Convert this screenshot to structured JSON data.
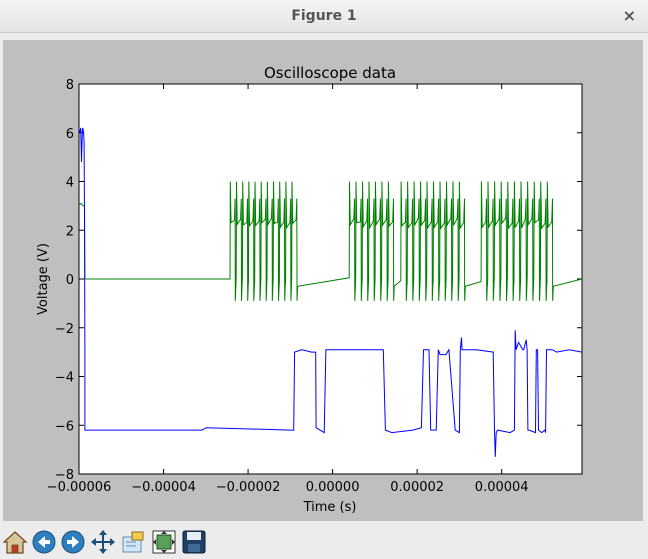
{
  "window": {
    "title": "Figure 1",
    "close_glyph": "×"
  },
  "toolbar": {
    "buttons": [
      {
        "name": "home-icon",
        "tooltip": "Home"
      },
      {
        "name": "back-icon",
        "tooltip": "Back"
      },
      {
        "name": "forward-icon",
        "tooltip": "Forward"
      },
      {
        "name": "pan-icon",
        "tooltip": "Pan"
      },
      {
        "name": "zoom-icon",
        "tooltip": "Zoom"
      },
      {
        "name": "subplots-icon",
        "tooltip": "Subplots"
      },
      {
        "name": "save-icon",
        "tooltip": "Save"
      }
    ]
  },
  "chart_data": {
    "type": "line",
    "title": "Oscilloscope data",
    "xlabel": "Time (s)",
    "ylabel": "Voltage (V)",
    "xlim": [
      -6e-05,
      5.9e-05
    ],
    "ylim": [
      -8,
      8
    ],
    "xticks": [
      -6e-05,
      -4e-05,
      -2e-05,
      0.0,
      2e-05,
      4e-05
    ],
    "xtick_labels": [
      "−0.00006",
      "−0.00004",
      "−0.00002",
      "0.00000",
      "0.00002",
      "0.00004"
    ],
    "yticks": [
      -8,
      -6,
      -4,
      -2,
      0,
      2,
      4,
      6,
      8
    ],
    "ytick_labels": [
      "−8",
      "−6",
      "−4",
      "−2",
      "0",
      "2",
      "4",
      "6",
      "8"
    ],
    "grid": false,
    "series": [
      {
        "color": "#0000ff",
        "x": [
          -6.1e-05,
          -6.05e-05,
          -6.03e-05,
          -5.98e-05,
          -5.96e-05,
          -5.94e-05,
          -5.92e-05,
          -5.91e-05,
          -5.89e-05,
          -5.88e-05,
          -5.87e-05,
          -5.86e-05,
          -5.86e-05,
          -5.84e-05,
          -3.09e-05,
          -2.99e-05,
          -9.9e-06,
          -9.2e-06,
          -9e-06,
          -7.3e-06,
          -5e-06,
          -4e-06,
          -3.9e-06,
          -2e-06,
          -1.6e-06,
          -1.5e-06,
          3e-06,
          5e-06,
          1.2e-05,
          1.25e-05,
          1.4e-05,
          1.9e-05,
          2.1e-05,
          2.15e-05,
          2.28e-05,
          2.32e-05,
          2.45e-05,
          2.5e-05,
          2.54e-05,
          2.68e-05,
          2.75e-05,
          2.9e-05,
          3e-05,
          3.02e-05,
          3.05e-05,
          3.06e-05,
          3.4e-05,
          3.8e-05,
          3.83e-05,
          3.85e-05,
          3.87e-05,
          3.9e-05,
          4.2e-05,
          4.3e-05,
          4.32e-05,
          4.34e-05,
          4.4e-05,
          4.5e-05,
          4.52e-05,
          4.58e-05,
          4.6e-05,
          4.62e-05,
          4.65e-05,
          4.8e-05,
          4.82e-05,
          4.85e-05,
          4.87e-05,
          4.95e-05,
          5.02e-05,
          5.04e-05,
          5.06e-05,
          5.15e-05,
          5.2e-05,
          5.3e-05,
          5.6e-05,
          5.9e-05
        ],
        "y": [
          6.3,
          5.5,
          6.4,
          6.0,
          6.2,
          4.8,
          6.1,
          6.2,
          6.0,
          5.6,
          2.5,
          -3.0,
          -6.2,
          -6.2,
          -6.2,
          -6.1,
          -6.2,
          -6.2,
          -3.0,
          -2.9,
          -3.0,
          -3.0,
          -6.1,
          -6.3,
          -2.9,
          -2.9,
          -2.9,
          -2.9,
          -2.9,
          -6.2,
          -6.3,
          -6.2,
          -6.1,
          -2.9,
          -2.9,
          -6.2,
          -6.2,
          -2.9,
          -3.1,
          -3.1,
          -2.9,
          -6.2,
          -6.3,
          -2.9,
          -2.4,
          -2.9,
          -2.9,
          -3.0,
          -6.2,
          -7.3,
          -6.3,
          -6.2,
          -6.3,
          -6.2,
          -2.1,
          -2.9,
          -2.6,
          -2.9,
          -2.9,
          -2.5,
          -2.9,
          -6.2,
          -6.2,
          -6.3,
          -2.9,
          -2.9,
          -6.2,
          -6.3,
          -6.2,
          -6.3,
          -2.9,
          -2.9,
          -2.9,
          -3.0,
          -2.9,
          -3.0
        ]
      },
      {
        "color": "#008000",
        "x": [
          -6.1e-05,
          -6.03e-05,
          -5.95e-05,
          -5.9e-05,
          -5.87e-05,
          -5.86e-05,
          -5.8e-05,
          -2.5e-05
        ],
        "y": [
          3.1,
          3.0,
          3.1,
          3.0,
          3.0,
          0.0,
          0.0,
          0.0
        ],
        "burst_groups": [
          {
            "start": -2.42e-05,
            "end": -9.6e-06,
            "pulses": 11
          },
          {
            "start": 4e-06,
            "end": 1.32e-05,
            "pulses": 7
          },
          {
            "start": 1.62e-05,
            "end": 3e-05,
            "pulses": 10
          },
          {
            "start": 3.52e-05,
            "end": 5.08e-05,
            "pulses": 11
          }
        ],
        "pulse_high": 4.0,
        "pulse_low": -0.9,
        "baseline": 0.0
      }
    ]
  }
}
